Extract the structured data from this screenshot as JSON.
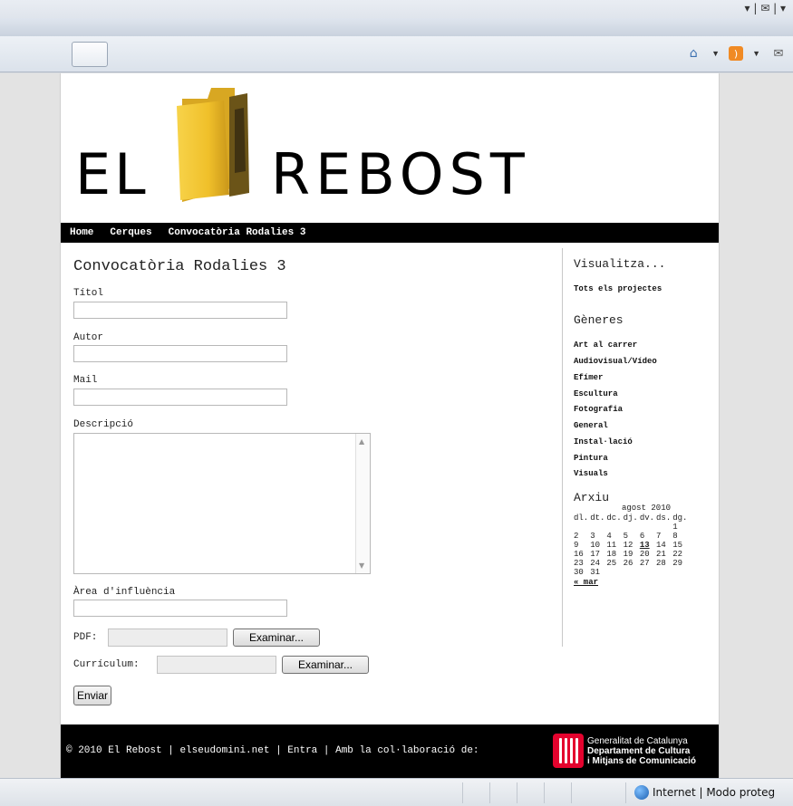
{
  "chrome": {
    "top_right_icons": "▾ | ✉ | ▾",
    "tools": {
      "home_icon": "home-icon",
      "rss_icon": "rss-icon",
      "mail_icon": "mail-icon"
    }
  },
  "logo": {
    "left_text": "EL",
    "right_text": "REBOST"
  },
  "nav": {
    "items": [
      "Home",
      "Cerques",
      "Convocatòria Rodalies 3"
    ]
  },
  "form": {
    "title": "Convocatòria Rodalies 3",
    "titol_label": "Títol",
    "titol_value": "",
    "autor_label": "Autor",
    "autor_value": "",
    "mail_label": "Mail",
    "mail_value": "",
    "descripcio_label": "Descripció",
    "descripcio_value": "",
    "area_label": "Àrea d'influència",
    "area_value": "",
    "pdf_label": "PDF:",
    "curriculum_label": "Currículum:",
    "browse_label": "Examinar...",
    "submit_label": "Enviar"
  },
  "sidebar": {
    "visualitza_heading": "Visualitza...",
    "tots_link": "Tots els projectes",
    "generes_heading": "Gèneres",
    "generes": [
      "Art al carrer",
      "Audiovisual/Vídeo",
      "Efímer",
      "Escultura",
      "Fotografia",
      "General",
      "Instal·lació",
      "Pintura",
      "Visuals"
    ],
    "arxiu_heading": "Arxiu",
    "calendar": {
      "caption": "agost 2010",
      "days": [
        "dl.",
        "dt.",
        "dc.",
        "dj.",
        "dv.",
        "ds.",
        "dg."
      ],
      "weeks": [
        [
          "",
          "",
          "",
          "",
          "",
          "",
          "1"
        ],
        [
          "2",
          "3",
          "4",
          "5",
          "6",
          "7",
          "8"
        ],
        [
          "9",
          "10",
          "11",
          "12",
          "13",
          "14",
          "15"
        ],
        [
          "16",
          "17",
          "18",
          "19",
          "20",
          "21",
          "22"
        ],
        [
          "23",
          "24",
          "25",
          "26",
          "27",
          "28",
          "29"
        ],
        [
          "30",
          "31",
          "",
          "",
          "",
          "",
          ""
        ]
      ],
      "today": "13",
      "prev_link": "« mar"
    }
  },
  "footer": {
    "copyright": "© 2010 El Rebost",
    "sep": " | ",
    "domain": "elseudomini.net",
    "entra": "Entra",
    "collab": "Amb la col·laboració de:",
    "gen_line1": "Generalitat de Catalunya",
    "gen_line2": "Departament de Cultura",
    "gen_line3": "i Mitjans de Comunicació"
  },
  "statusbar": {
    "zone_text": "Internet | Modo proteg"
  },
  "colors": {
    "folder": "#f2c531",
    "footer_bg": "#000000",
    "nav_bg": "#000000",
    "generalitat_red": "#e4032e"
  }
}
